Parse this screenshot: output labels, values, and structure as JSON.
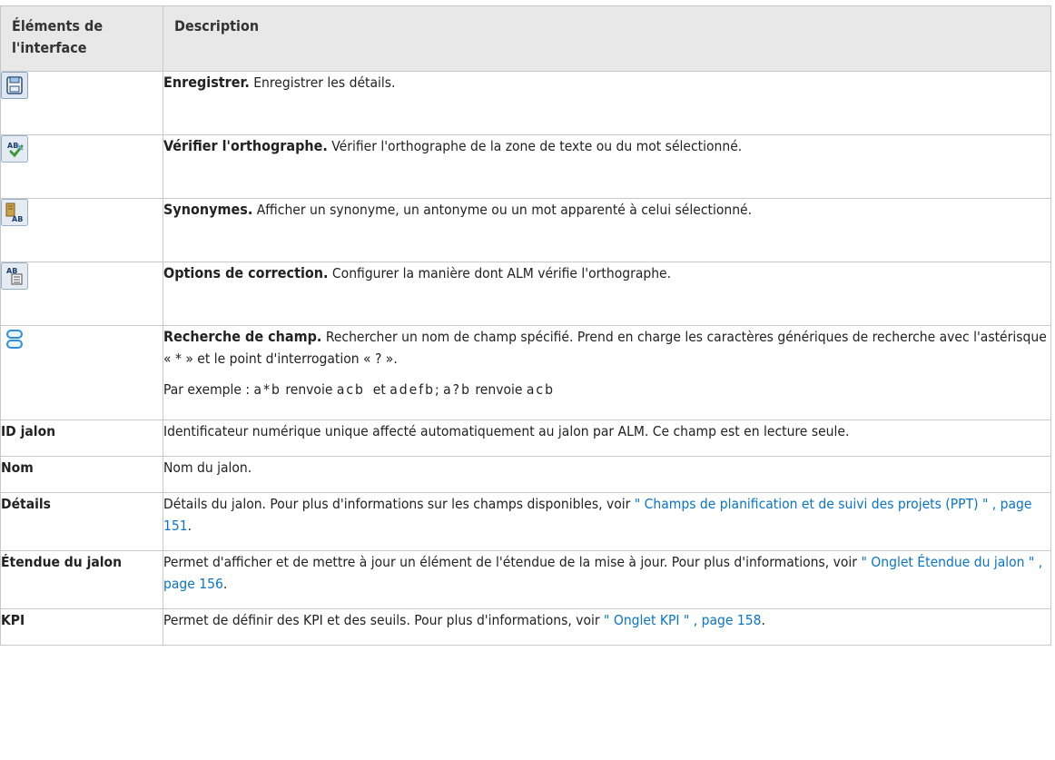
{
  "header": {
    "col1": "Éléments de l'interface",
    "col2": "Description"
  },
  "icon_rows": [
    {
      "icon": "save-icon",
      "title": "Enregistrer.",
      "text": " Enregistrer les détails."
    },
    {
      "icon": "spell-check-icon",
      "title": "Vérifier l'orthographe.",
      "text": " Vérifier l'orthographe de la zone de texte ou du mot sélectionné."
    },
    {
      "icon": "thesaurus-icon",
      "title": "Synonymes.",
      "text": " Afficher un synonyme, un antonyme ou un mot apparenté à celui sélectionné."
    },
    {
      "icon": "spelling-options-icon",
      "title": "Options de correction.",
      "text": " Configurer la manière dont ALM vérifie l'orthographe."
    },
    {
      "icon": "field-search-icon",
      "title": "Recherche de champ.",
      "text": " Rechercher un nom de champ spécifié. Prend en charge les caractères génériques de recherche avec l'astérisque « * » et le point d'interrogation « ? ».",
      "example": {
        "prefix": "Par exemple : ",
        "e1": "a*b",
        "m1": " renvoie ",
        "e2": "acb",
        "m2": "  et ",
        "e3": "adefb",
        "m3": "; ",
        "e4": "a?b",
        "m4": " renvoie ",
        "e5": "acb"
      }
    }
  ],
  "rows": [
    {
      "name": "ID jalon",
      "desc": "Identificateur numérique unique affecté automatiquement au jalon par ALM. Ce champ est en lecture seule."
    },
    {
      "name": "Nom",
      "desc": "Nom du jalon."
    },
    {
      "name": "Détails",
      "desc": "Détails du jalon. Pour plus d'informations sur les champs disponibles, voir ",
      "link": "\" Champs de planification et de suivi des projets (PPT) \" , page 151",
      "tail": "."
    },
    {
      "name": "Étendue du jalon",
      "desc": "Permet d'afficher et de mettre à jour un élément de l'étendue de la mise à jour. Pour plus d'informations, voir ",
      "link": "\" Onglet Étendue du jalon \" , page 156",
      "tail": "."
    },
    {
      "name": "KPI",
      "desc": "Permet de définir des KPI et des seuils. Pour plus d'informations, voir ",
      "link": "\" Onglet KPI \" , page 158",
      "tail": "."
    }
  ]
}
